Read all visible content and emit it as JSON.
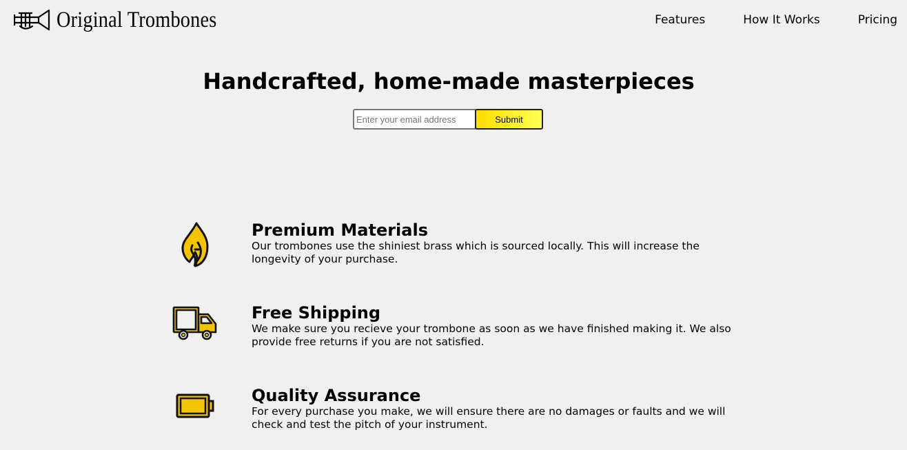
{
  "brand": {
    "name": "Original Trombones",
    "logo_icon": "trombone-icon"
  },
  "nav": {
    "items": [
      {
        "label": "Features"
      },
      {
        "label": "How It Works"
      },
      {
        "label": "Pricing"
      }
    ]
  },
  "hero": {
    "title": "Handcrafted, home-made masterpieces",
    "email_placeholder": "Enter your email address",
    "email_value": "",
    "submit_label": "Submit"
  },
  "features": [
    {
      "icon": "flame-icon",
      "title": "Premium Materials",
      "description": "Our trombones use the shiniest brass which is sourced locally. This will increase the longevity of your purchase."
    },
    {
      "icon": "truck-icon",
      "title": "Free Shipping",
      "description": "We make sure you recieve your trombone as soon as we have finished making it. We also provide free returns if you are not satisfied."
    },
    {
      "icon": "battery-icon",
      "title": "Quality Assurance",
      "description": "For every purchase you make, we will ensure there are no damages or faults and we will check and test the pitch of your instrument."
    }
  ],
  "colors": {
    "background": "#f0f0f0",
    "accent_yellow": "#ffdd00",
    "text": "#000000"
  }
}
